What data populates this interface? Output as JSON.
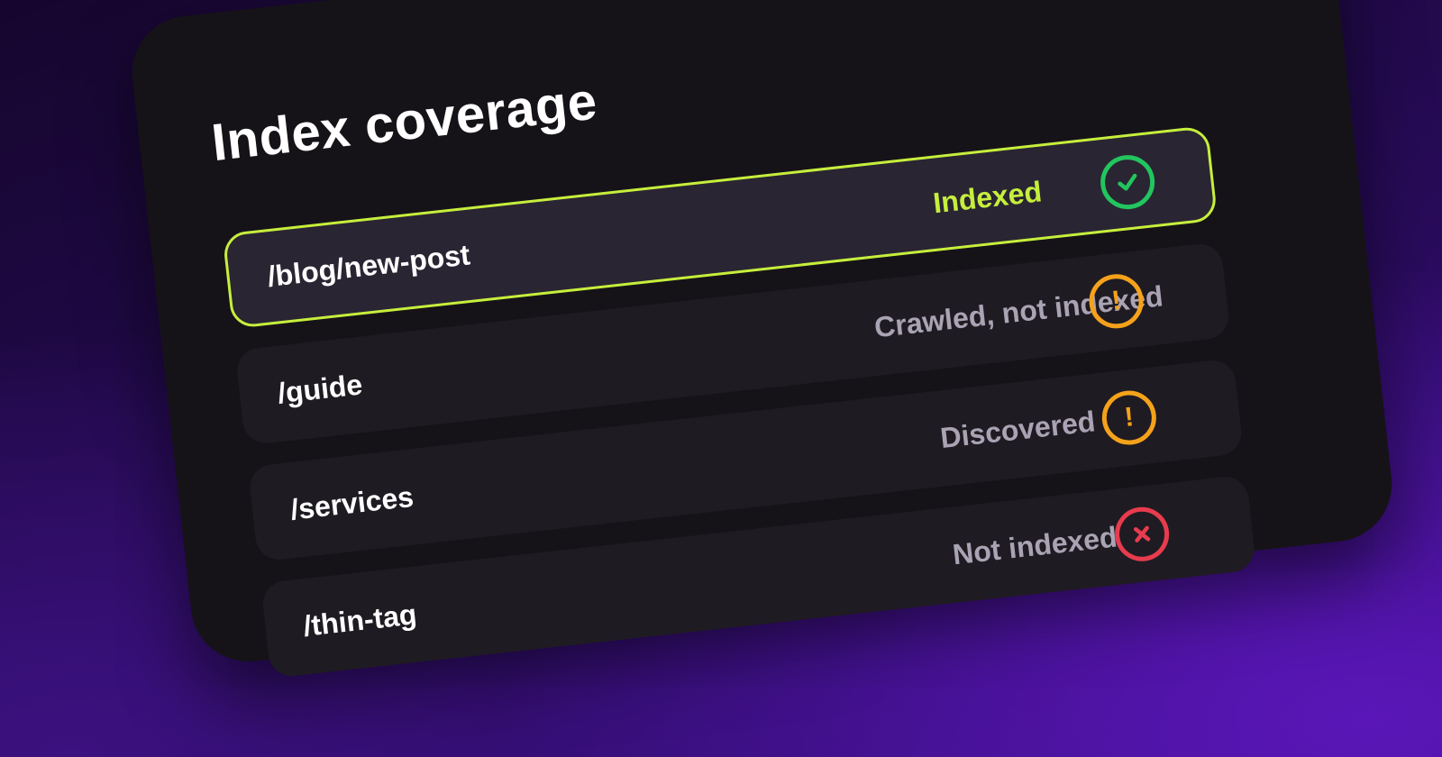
{
  "card": {
    "title": "Index coverage"
  },
  "rows": [
    {
      "path": "/blog/new-post",
      "status": "Indexed",
      "icon": "check-circle-icon",
      "tone": "success"
    },
    {
      "path": "/guide",
      "status": "Crawled, not indexed",
      "icon": "exclamation-circle-icon",
      "tone": "warning"
    },
    {
      "path": "/services",
      "status": "Discovered",
      "icon": "exclamation-circle-icon",
      "tone": "warning"
    },
    {
      "path": "/thin-tag",
      "status": "Not indexed",
      "icon": "x-circle-icon",
      "tone": "error"
    }
  ],
  "colors": {
    "accent": "#c6ef3c",
    "success": "#22c55e",
    "warning": "#f5a21b",
    "error": "#e73c4e"
  }
}
